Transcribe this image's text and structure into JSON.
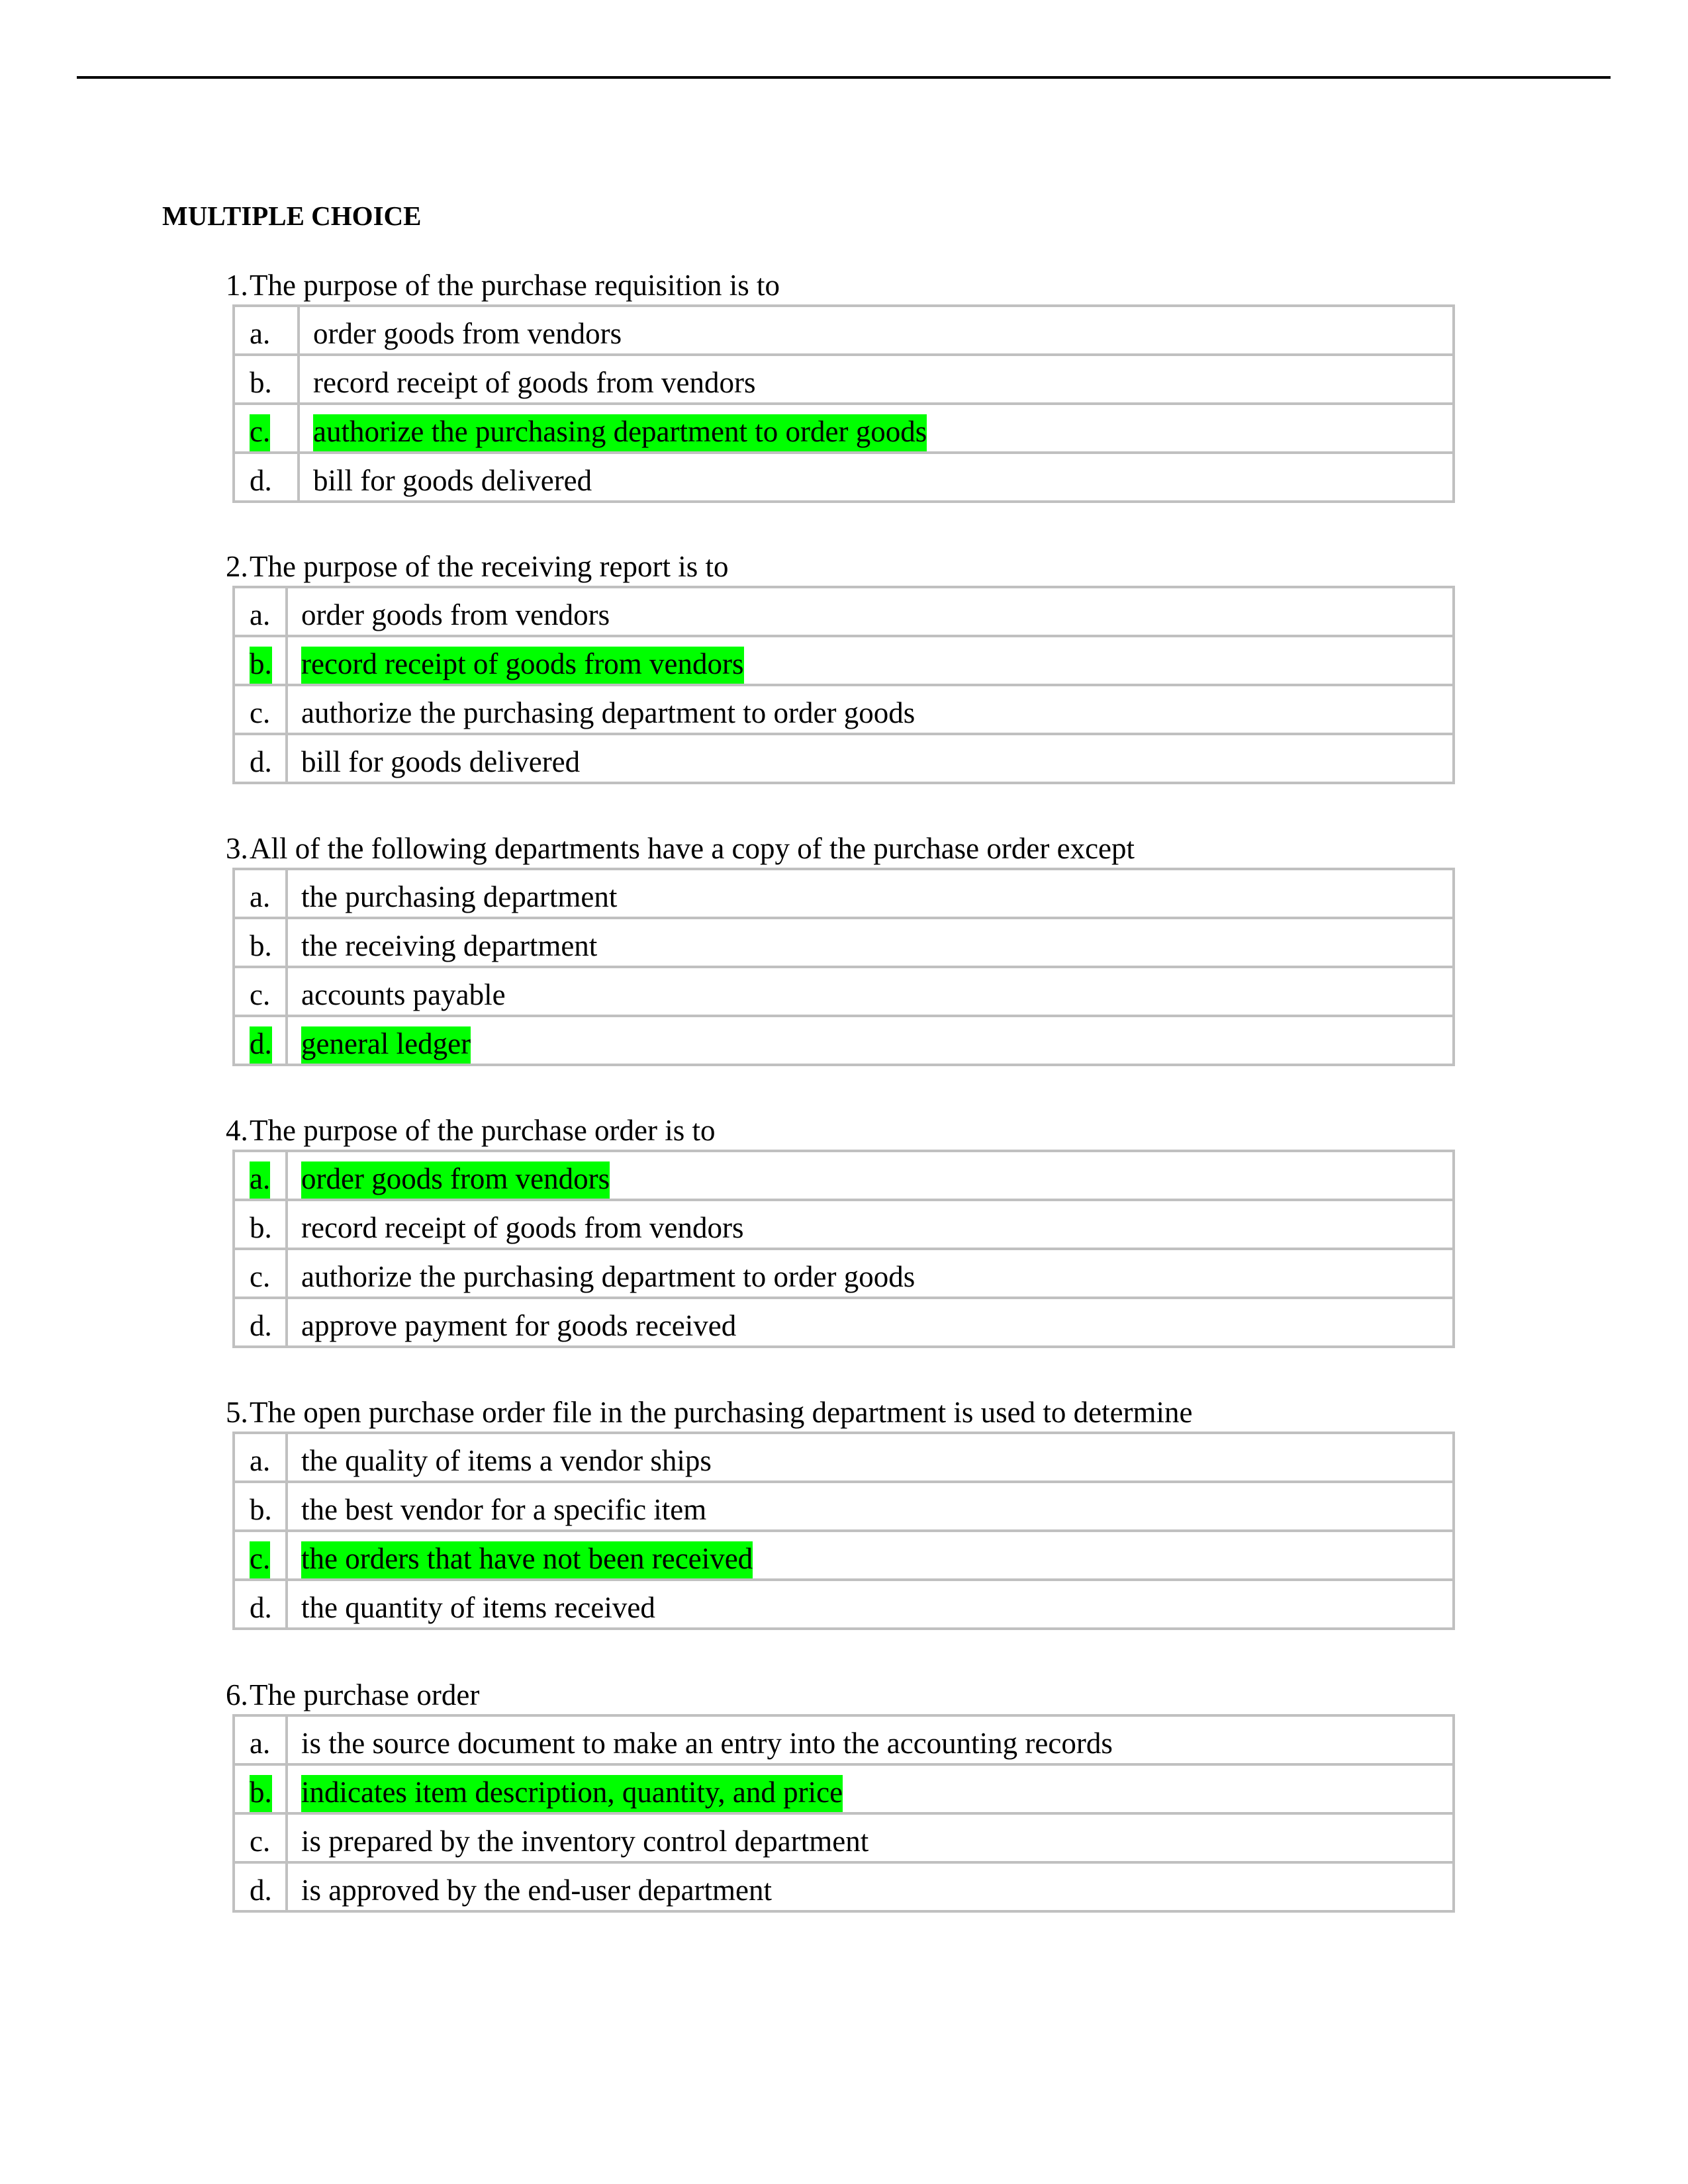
{
  "document": {
    "section_heading": "MULTIPLE CHOICE",
    "highlight_color": "#00ff00",
    "questions": [
      {
        "number": "1.",
        "text": "The purpose of the purchase requisition is to",
        "correct": "c",
        "choices": [
          {
            "letter": "a.",
            "text": "order goods from vendors",
            "highlighted": false
          },
          {
            "letter": "b.",
            "text": "record receipt of goods from vendors",
            "highlighted": false
          },
          {
            "letter": "c.",
            "text": "authorize the purchasing department to order goods",
            "highlighted": true
          },
          {
            "letter": "d.",
            "text": "bill for goods delivered",
            "highlighted": false
          }
        ]
      },
      {
        "number": "2.",
        "text": "The purpose of the receiving report is to",
        "correct": "b",
        "choices": [
          {
            "letter": "a.",
            "text": "order goods from vendors",
            "highlighted": false
          },
          {
            "letter": "b.",
            "text": "record receipt of goods from vendors",
            "highlighted": true
          },
          {
            "letter": "c.",
            "text": "authorize the purchasing department to order goods",
            "highlighted": false
          },
          {
            "letter": "d.",
            "text": "bill for goods delivered",
            "highlighted": false
          }
        ]
      },
      {
        "number": "3.",
        "text": "All of the following departments have a copy of the purchase order except",
        "correct": "d",
        "choices": [
          {
            "letter": "a.",
            "text": "the purchasing department",
            "highlighted": false
          },
          {
            "letter": "b.",
            "text": "the receiving department",
            "highlighted": false
          },
          {
            "letter": "c.",
            "text": "accounts payable",
            "highlighted": false
          },
          {
            "letter": "d.",
            "text": "general ledger",
            "highlighted": true
          }
        ]
      },
      {
        "number": "4.",
        "text": "The purpose of the purchase order is to",
        "correct": "a",
        "choices": [
          {
            "letter": "a.",
            "text": "order goods from vendors",
            "highlighted": true
          },
          {
            "letter": "b.",
            "text": "record receipt of goods from vendors",
            "highlighted": false
          },
          {
            "letter": "c.",
            "text": "authorize the purchasing department to order goods",
            "highlighted": false
          },
          {
            "letter": "d.",
            "text": "approve payment for goods received",
            "highlighted": false
          }
        ]
      },
      {
        "number": "5.",
        "text": "The open purchase order file in the purchasing department is used to determine",
        "correct": "c",
        "choices": [
          {
            "letter": "a.",
            "text": "the quality of items a vendor ships",
            "highlighted": false
          },
          {
            "letter": "b.",
            "text": "the best vendor for a specific item",
            "highlighted": false
          },
          {
            "letter": "c.",
            "text": "the orders that have not been received",
            "highlighted": true
          },
          {
            "letter": "d.",
            "text": "the quantity of items received",
            "highlighted": false
          }
        ]
      },
      {
        "number": "6.",
        "text": "The purchase order",
        "correct": "b",
        "choices": [
          {
            "letter": "a.",
            "text": "is the source document to make an entry into the accounting records",
            "highlighted": false
          },
          {
            "letter": "b.",
            "text": "indicates item description, quantity, and price",
            "highlighted": true
          },
          {
            "letter": "c.",
            "text": "is prepared by the inventory control department",
            "highlighted": false
          },
          {
            "letter": "d.",
            "text": "is approved by the end-user department",
            "highlighted": false
          }
        ]
      }
    ]
  }
}
